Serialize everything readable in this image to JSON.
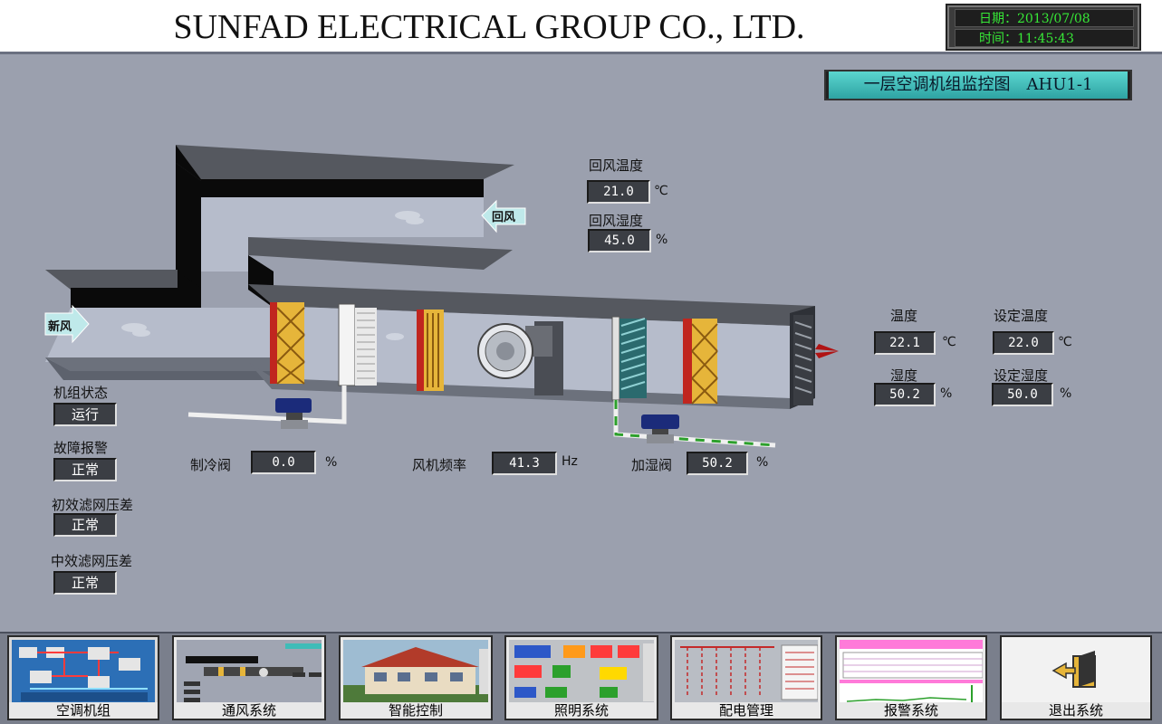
{
  "header": {
    "company": "SUNFAD ELECTRICAL GROUP CO., LTD.",
    "date_label": "日期：2013/07/08",
    "time_label": "时间：11:45:43"
  },
  "title_plate": "一层空调机组监控图　AHU1-1",
  "duct": {
    "return_air_label": "回风",
    "fresh_air_label": "新风"
  },
  "return_air": {
    "temp_label": "回风温度",
    "temp_value": "21.0",
    "temp_unit": "℃",
    "humidity_label": "回风湿度",
    "humidity_value": "45.0",
    "humidity_unit": "%"
  },
  "supply": {
    "temp_label": "温度",
    "temp_value": "22.1",
    "temp_unit": "℃",
    "humidity_label": "湿度",
    "humidity_value": "50.2",
    "humidity_unit": "%",
    "set_temp_label": "设定温度",
    "set_temp_value": "22.0",
    "set_temp_unit": "℃",
    "set_humidity_label": "设定湿度",
    "set_humidity_value": "50.0",
    "set_humidity_unit": "%"
  },
  "status": {
    "unit_state_label": "机组状态",
    "unit_state_value": "运行",
    "fault_label": "故障报警",
    "fault_value": "正常",
    "primary_filter_label": "初效滤网压差",
    "primary_filter_value": "正常",
    "medium_filter_label": "中效滤网压差",
    "medium_filter_value": "正常"
  },
  "controls": {
    "cooling_valve_label": "制冷阀",
    "cooling_valve_value": "0.0",
    "cooling_valve_unit": "%",
    "fan_freq_label": "风机频率",
    "fan_freq_value": "41.3",
    "fan_freq_unit": "Hz",
    "humidify_valve_label": "加湿阀",
    "humidify_valve_value": "50.2",
    "humidify_valve_unit": "%"
  },
  "nav": {
    "items": [
      {
        "label": "空调机组"
      },
      {
        "label": "通风系统"
      },
      {
        "label": "智能控制"
      },
      {
        "label": "照明系统"
      },
      {
        "label": "配电管理"
      },
      {
        "label": "报警系统"
      },
      {
        "label": "退出系统"
      }
    ]
  },
  "colors": {
    "background": "#9ba0ae",
    "display_box": "#3b3e44",
    "clock_text": "#37e837",
    "title_plate": "#3fbcb8",
    "duct_dark": "#0a0a0a",
    "duct_top": "#55585f",
    "filter_red": "#c0261f",
    "filter_yellow": "#e6b53a"
  }
}
